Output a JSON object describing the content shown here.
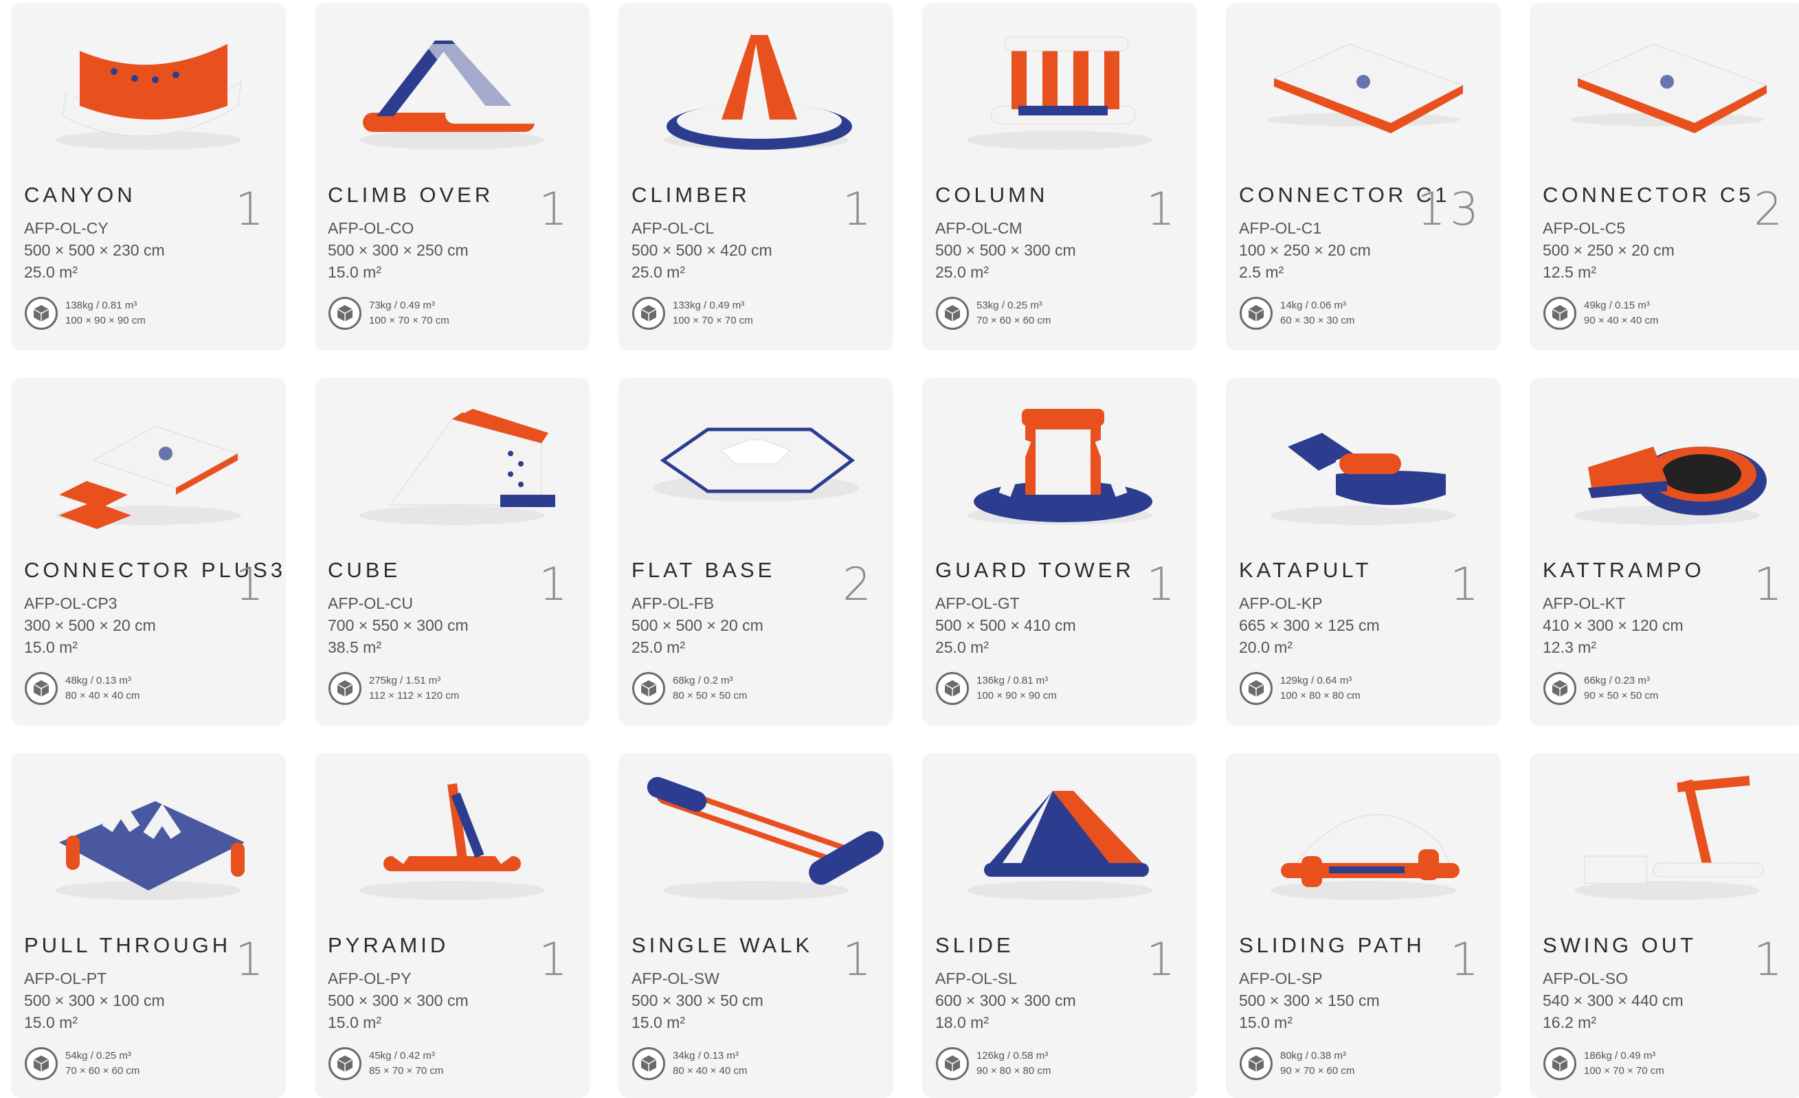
{
  "products": [
    {
      "name": "CANYON",
      "qty": "1",
      "code": "AFP-OL-CY",
      "dims": "500 × 500 × 230 cm",
      "area": "25.0 m²",
      "pack_weight": "138kg / 0.81 m³",
      "pack_dims": "100 × 90 × 90 cm"
    },
    {
      "name": "CLIMB OVER",
      "qty": "1",
      "code": "AFP-OL-CO",
      "dims": "500 × 300 × 250 cm",
      "area": "15.0 m²",
      "pack_weight": "73kg / 0.49 m³",
      "pack_dims": "100 × 70 × 70 cm"
    },
    {
      "name": "CLIMBER",
      "qty": "1",
      "code": "AFP-OL-CL",
      "dims": "500 × 500 × 420 cm",
      "area": "25.0 m²",
      "pack_weight": "133kg / 0.49 m³",
      "pack_dims": "100 × 70 × 70 cm"
    },
    {
      "name": "COLUMN",
      "qty": "1",
      "code": "AFP-OL-CM",
      "dims": "500 × 500 × 300 cm",
      "area": "25.0 m²",
      "pack_weight": "53kg / 0.25 m³",
      "pack_dims": "70 × 60 × 60 cm"
    },
    {
      "name": "CONNECTOR C1",
      "qty": "13",
      "code": "AFP-OL-C1",
      "dims": "100 × 250 × 20 cm",
      "area": "2.5 m²",
      "pack_weight": "14kg / 0.06 m³",
      "pack_dims": "60 × 30 × 30 cm"
    },
    {
      "name": "CONNECTOR C5",
      "qty": "2",
      "code": "AFP-OL-C5",
      "dims": "500 × 250 × 20 cm",
      "area": "12.5 m²",
      "pack_weight": "49kg / 0.15 m³",
      "pack_dims": "90 × 40 × 40 cm"
    },
    {
      "name": "CONNECTOR PLUS3",
      "qty": "1",
      "code": "AFP-OL-CP3",
      "dims": "300 × 500 × 20 cm",
      "area": "15.0 m²",
      "pack_weight": "48kg / 0.13 m³",
      "pack_dims": "80 × 40 × 40 cm"
    },
    {
      "name": "CUBE",
      "qty": "1",
      "code": "AFP-OL-CU",
      "dims": "700 × 550 × 300 cm",
      "area": "38.5 m²",
      "pack_weight": "275kg / 1.51 m³",
      "pack_dims": "112 × 112 × 120 cm"
    },
    {
      "name": "FLAT BASE",
      "qty": "2",
      "code": "AFP-OL-FB",
      "dims": "500 × 500 × 20 cm",
      "area": "25.0 m²",
      "pack_weight": "68kg / 0.2 m³",
      "pack_dims": "80 × 50 × 50 cm"
    },
    {
      "name": "GUARD TOWER",
      "qty": "1",
      "code": "AFP-OL-GT",
      "dims": "500 × 500 × 410 cm",
      "area": "25.0 m²",
      "pack_weight": "136kg / 0.81 m³",
      "pack_dims": "100 × 90 × 90 cm"
    },
    {
      "name": "KATAPULT",
      "qty": "1",
      "code": "AFP-OL-KP",
      "dims": "665 × 300 × 125 cm",
      "area": "20.0 m²",
      "pack_weight": "129kg / 0.64 m³",
      "pack_dims": "100 × 80 × 80 cm"
    },
    {
      "name": "KATTRAMPO",
      "qty": "1",
      "code": "AFP-OL-KT",
      "dims": "410 × 300 × 120 cm",
      "area": "12.3 m²",
      "pack_weight": "66kg / 0.23 m³",
      "pack_dims": "90 × 50 × 50 cm"
    },
    {
      "name": "PULL THROUGH",
      "qty": "1",
      "code": "AFP-OL-PT",
      "dims": "500 × 300 × 100 cm",
      "area": "15.0 m²",
      "pack_weight": "54kg / 0.25 m³",
      "pack_dims": "70 × 60 × 60 cm"
    },
    {
      "name": "PYRAMID",
      "qty": "1",
      "code": "AFP-OL-PY",
      "dims": "500 × 300 × 300 cm",
      "area": "15.0 m²",
      "pack_weight": "45kg / 0.42 m³",
      "pack_dims": "85 × 70 × 70 cm"
    },
    {
      "name": "SINGLE WALK",
      "qty": "1",
      "code": "AFP-OL-SW",
      "dims": "500 × 300 × 50 cm",
      "area": "15.0 m²",
      "pack_weight": "34kg / 0.13 m³",
      "pack_dims": "80 × 40 × 40 cm"
    },
    {
      "name": "SLIDE",
      "qty": "1",
      "code": "AFP-OL-SL",
      "dims": "600 × 300 × 300 cm",
      "area": "18.0 m²",
      "pack_weight": "126kg / 0.58 m³",
      "pack_dims": "90 × 80 × 80 cm"
    },
    {
      "name": "SLIDING PATH",
      "qty": "1",
      "code": "AFP-OL-SP",
      "dims": "500 × 300 × 150 cm",
      "area": "15.0 m²",
      "pack_weight": "80kg / 0.38 m³",
      "pack_dims": "90 × 70 × 60 cm"
    },
    {
      "name": "SWING OUT",
      "qty": "1",
      "code": "AFP-OL-SO",
      "dims": "540 × 300 × 440 cm",
      "area": "16.2 m²",
      "pack_weight": "186kg / 0.49 m³",
      "pack_dims": "100 × 70 × 70 cm"
    }
  ],
  "colors": {
    "orange": "#e8501e",
    "blue": "#2c3d8f",
    "white": "#f2f2f2",
    "card": "#f4f4f4"
  },
  "icon_names": {
    "package": "package-box-icon"
  }
}
